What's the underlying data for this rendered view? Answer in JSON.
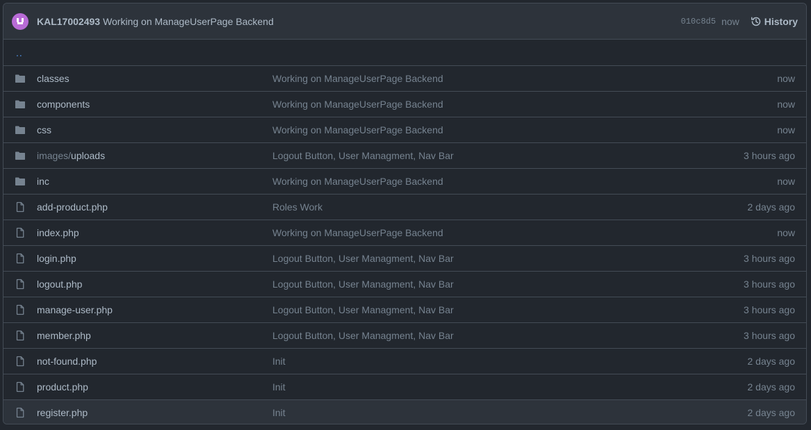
{
  "header": {
    "author": "KAL17002493",
    "message": "Working on ManageUserPage Backend",
    "sha": "010c8d5",
    "time": "now",
    "history_label": "History"
  },
  "parent_dir": "..",
  "files": [
    {
      "type": "dir",
      "prefix": "",
      "name": "classes",
      "commit": "Working on ManageUserPage Backend",
      "age": "now"
    },
    {
      "type": "dir",
      "prefix": "",
      "name": "components",
      "commit": "Working on ManageUserPage Backend",
      "age": "now"
    },
    {
      "type": "dir",
      "prefix": "",
      "name": "css",
      "commit": "Working on ManageUserPage Backend",
      "age": "now"
    },
    {
      "type": "dir",
      "prefix": "images/",
      "name": "uploads",
      "commit": "Logout Button, User Managment, Nav Bar",
      "age": "3 hours ago"
    },
    {
      "type": "dir",
      "prefix": "",
      "name": "inc",
      "commit": "Working on ManageUserPage Backend",
      "age": "now"
    },
    {
      "type": "file",
      "prefix": "",
      "name": "add-product.php",
      "commit": "Roles Work",
      "age": "2 days ago"
    },
    {
      "type": "file",
      "prefix": "",
      "name": "index.php",
      "commit": "Working on ManageUserPage Backend",
      "age": "now"
    },
    {
      "type": "file",
      "prefix": "",
      "name": "login.php",
      "commit": "Logout Button, User Managment, Nav Bar",
      "age": "3 hours ago"
    },
    {
      "type": "file",
      "prefix": "",
      "name": "logout.php",
      "commit": "Logout Button, User Managment, Nav Bar",
      "age": "3 hours ago"
    },
    {
      "type": "file",
      "prefix": "",
      "name": "manage-user.php",
      "commit": "Logout Button, User Managment, Nav Bar",
      "age": "3 hours ago"
    },
    {
      "type": "file",
      "prefix": "",
      "name": "member.php",
      "commit": "Logout Button, User Managment, Nav Bar",
      "age": "3 hours ago"
    },
    {
      "type": "file",
      "prefix": "",
      "name": "not-found.php",
      "commit": "Init",
      "age": "2 days ago"
    },
    {
      "type": "file",
      "prefix": "",
      "name": "product.php",
      "commit": "Init",
      "age": "2 days ago"
    },
    {
      "type": "file",
      "prefix": "",
      "name": "register.php",
      "commit": "Init",
      "age": "2 days ago"
    }
  ],
  "colors": {
    "background": "#22272e",
    "header_bg": "#2d333b",
    "border": "#444c56",
    "link": "#539bf5",
    "muted": "#768390",
    "text": "#adbac7",
    "avatar": "#b86bd6"
  },
  "icons": {
    "dir": "folder-icon",
    "file": "file-icon",
    "history": "history-icon"
  }
}
